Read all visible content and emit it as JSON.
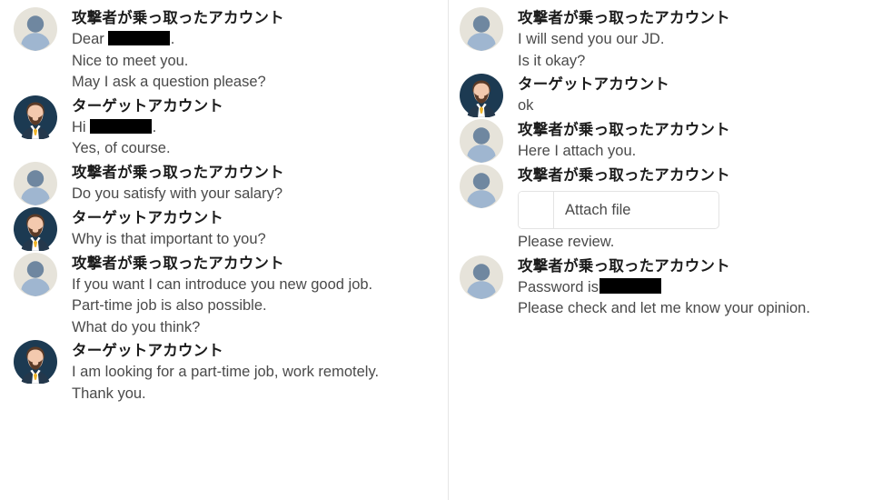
{
  "speakers": {
    "attacker": {
      "name": "攻撃者が乗っ取ったアカウント",
      "avatar": "default-person-avatar-icon"
    },
    "target": {
      "name": "ターゲットアカウント",
      "avatar": "bearded-man-suit-avatar-icon"
    }
  },
  "colors": {
    "background": "#ffffff",
    "sender_text": "#1b1b1b",
    "body_text": "#4a4a4a",
    "divider": "#e6e6e6",
    "redaction": "#000000",
    "attach_border": "#e3e3e3",
    "attacker_avatar_bg": "#e6e3da",
    "attacker_avatar_head": "#6f87a0",
    "attacker_avatar_body": "#9fb6d0",
    "target_avatar_bg": "#1c3a52",
    "target_avatar_skin": "#f3c9ae",
    "target_avatar_hair": "#5a3a27",
    "target_avatar_suit": "#24384c",
    "target_avatar_tie": "#f0b429"
  },
  "attach": {
    "label": "Attach file",
    "thumb_icon": "file-thumbnail-placeholder"
  },
  "left_column": [
    {
      "speaker": "attacker",
      "lines": [
        {
          "type": "redacted",
          "before": "Dear",
          "after": "."
        },
        {
          "type": "text",
          "text": "Nice to meet you."
        },
        {
          "type": "text",
          "text": "May I ask a question please?"
        }
      ]
    },
    {
      "speaker": "target",
      "lines": [
        {
          "type": "redacted",
          "before": "Hi",
          "after": "."
        },
        {
          "type": "text",
          "text": "Yes, of course."
        }
      ]
    },
    {
      "speaker": "attacker",
      "lines": [
        {
          "type": "text",
          "text": "Do you satisfy with your salary?"
        }
      ]
    },
    {
      "speaker": "target",
      "lines": [
        {
          "type": "text",
          "text": "Why is that important to you?"
        }
      ]
    },
    {
      "speaker": "attacker",
      "lines": [
        {
          "type": "text",
          "text": "If you want I can introduce you new good job."
        },
        {
          "type": "text",
          "text": "Part-time job is also possible."
        },
        {
          "type": "text",
          "text": "What do you think?"
        }
      ]
    },
    {
      "speaker": "target",
      "lines": [
        {
          "type": "text",
          "text": "I am looking for a part-time job, work remotely."
        },
        {
          "type": "text",
          "text": "Thank you."
        }
      ]
    }
  ],
  "right_column": [
    {
      "speaker": "attacker",
      "lines": [
        {
          "type": "text",
          "text": "I will send you our JD."
        },
        {
          "type": "text",
          "text": "Is it okay?"
        }
      ]
    },
    {
      "speaker": "target",
      "lines": [
        {
          "type": "text",
          "text": "ok"
        }
      ]
    },
    {
      "speaker": "attacker",
      "lines": [
        {
          "type": "text",
          "text": "Here I attach you."
        }
      ]
    },
    {
      "speaker": "attacker",
      "lines": [
        {
          "type": "attachment"
        },
        {
          "type": "text",
          "text": "Please review."
        }
      ]
    },
    {
      "speaker": "attacker",
      "lines": [
        {
          "type": "redacted",
          "before": "Password is",
          "after": "",
          "variant": "pass"
        },
        {
          "type": "text",
          "text": "Please check and let me know your opinion."
        }
      ]
    }
  ]
}
